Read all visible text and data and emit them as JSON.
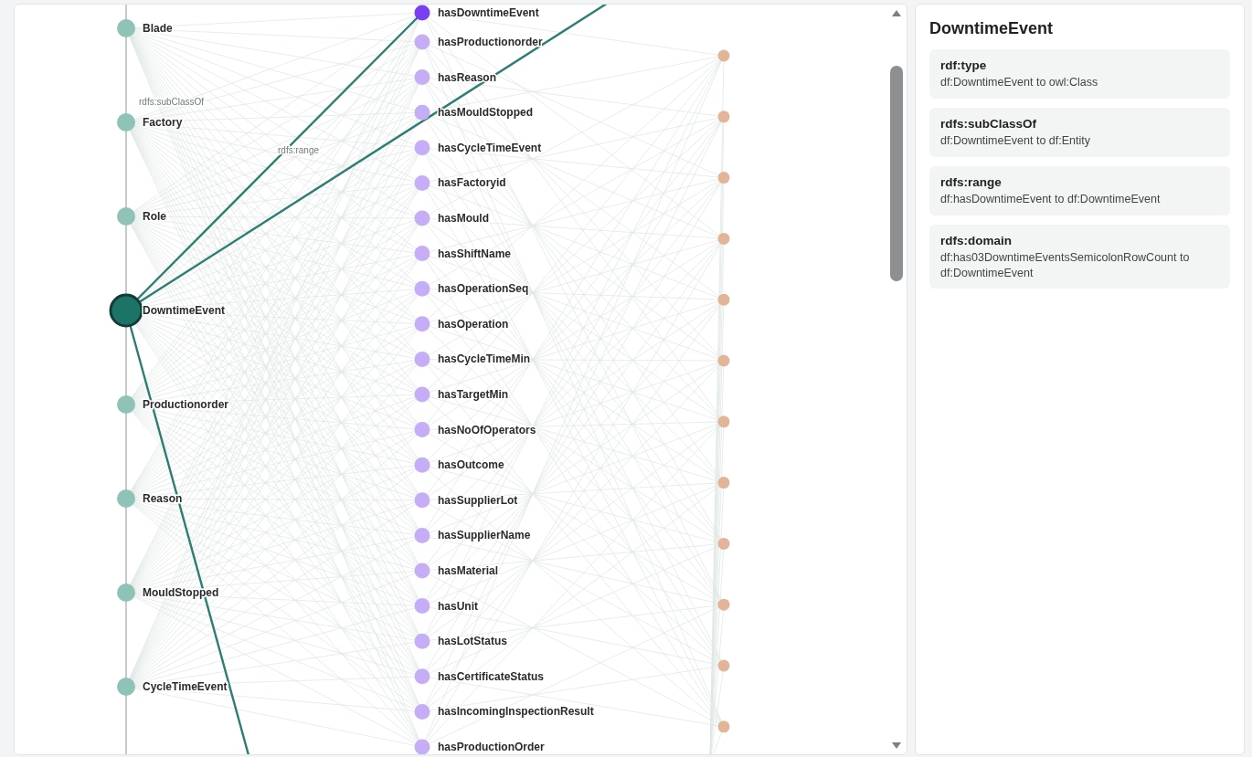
{
  "graph": {
    "classes": [
      {
        "label": "Blade",
        "selected": false
      },
      {
        "label": "Factory",
        "selected": false
      },
      {
        "label": "Role",
        "selected": false
      },
      {
        "label": "DowntimeEvent",
        "selected": true
      },
      {
        "label": "Productionorder",
        "selected": false
      },
      {
        "label": "Reason",
        "selected": false
      },
      {
        "label": "MouldStopped",
        "selected": false
      },
      {
        "label": "CycleTimeEvent",
        "selected": false
      }
    ],
    "properties": [
      {
        "label": "hasDowntimeEvent",
        "selected": true
      },
      {
        "label": "hasProductionorder",
        "selected": false
      },
      {
        "label": "hasReason",
        "selected": false
      },
      {
        "label": "hasMouldStopped",
        "selected": false
      },
      {
        "label": "hasCycleTimeEvent",
        "selected": false
      },
      {
        "label": "hasFactoryid",
        "selected": false
      },
      {
        "label": "hasMould",
        "selected": false
      },
      {
        "label": "hasShiftName",
        "selected": false
      },
      {
        "label": "hasOperationSeq",
        "selected": false
      },
      {
        "label": "hasOperation",
        "selected": false
      },
      {
        "label": "hasCycleTimeMin",
        "selected": false
      },
      {
        "label": "hasTargetMin",
        "selected": false
      },
      {
        "label": "hasNoOfOperators",
        "selected": false
      },
      {
        "label": "hasOutcome",
        "selected": false
      },
      {
        "label": "hasSupplierLot",
        "selected": false
      },
      {
        "label": "hasSupplierName",
        "selected": false
      },
      {
        "label": "hasMaterial",
        "selected": false
      },
      {
        "label": "hasUnit",
        "selected": false
      },
      {
        "label": "hasLotStatus",
        "selected": false
      },
      {
        "label": "hasCertificateStatus",
        "selected": false
      },
      {
        "label": "hasIncomingInspectionResult",
        "selected": false
      },
      {
        "label": "hasProductionOrder",
        "selected": false
      }
    ],
    "datatypes": [
      {
        "kind": "datatype"
      },
      {
        "kind": "datatype"
      },
      {
        "kind": "datatype"
      },
      {
        "kind": "datatype"
      },
      {
        "kind": "datatype"
      },
      {
        "kind": "datatype"
      },
      {
        "kind": "datatype"
      },
      {
        "kind": "datatype"
      },
      {
        "kind": "datatype"
      },
      {
        "kind": "datatype"
      },
      {
        "kind": "datatype"
      },
      {
        "kind": "datatype"
      }
    ],
    "edge_labels": [
      {
        "text": "rdfs:subClassOf",
        "kind": "subclass"
      },
      {
        "text": "rdfs:range",
        "kind": "range"
      }
    ]
  },
  "details": {
    "title": "DowntimeEvent",
    "triples": [
      {
        "predicate": "rdf:type",
        "statement": "df:DowntimeEvent to owl:Class"
      },
      {
        "predicate": "rdfs:subClassOf",
        "statement": "df:DowntimeEvent to df:Entity"
      },
      {
        "predicate": "rdfs:range",
        "statement": "df:hasDowntimeEvent to df:DowntimeEvent"
      },
      {
        "predicate": "rdfs:domain",
        "statement": "df:has03DowntimeEventsSemicolonRowCount to df:DowntimeEvent"
      }
    ]
  }
}
